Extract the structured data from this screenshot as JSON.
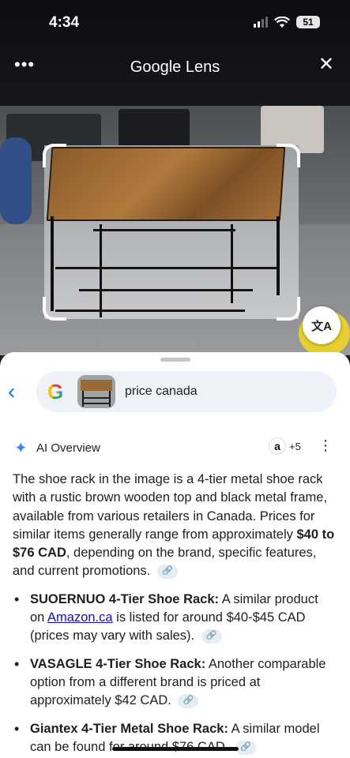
{
  "status": {
    "time": "4:34",
    "battery": "51"
  },
  "header": {
    "title": "Google Lens",
    "more_icon": "more-horiz-icon",
    "close_icon": "close-icon"
  },
  "photo": {
    "translate_label": "文A"
  },
  "search": {
    "logo": "G",
    "query": "price canada"
  },
  "ai_overview": {
    "label": "AI Overview",
    "sources_extra": "+5",
    "summary_pre": "The shoe rack in the image is a 4-tier metal shoe rack with a rustic brown wooden top and black metal frame, available from various retailers in Canada. Prices for similar items generally range from approximately ",
    "summary_bold": "$40 to $76 CAD",
    "summary_post": ", depending on the brand, specific features, and current promotions.",
    "items": [
      {
        "title": "SUOERNUO 4-Tier Shoe Rack:",
        "text_pre": " A similar product on ",
        "link": "Amazon.ca",
        "text_post": " is listed for around $40-$45 CAD (prices may vary with sales)."
      },
      {
        "title": "VASAGLE 4-Tier Shoe Rack:",
        "text_pre": " Another comparable option from a different brand is priced at approximately $42 CAD.",
        "link": "",
        "text_post": ""
      },
      {
        "title": "Giantex 4-Tier Metal Shoe Rack:",
        "text_pre": " A similar model can be found for around $76 CAD.",
        "link": "",
        "text_post": ""
      }
    ]
  },
  "colors": {
    "accent": "#1a73e8",
    "link": "#1a0dab",
    "table_wood": "#a46f38"
  }
}
